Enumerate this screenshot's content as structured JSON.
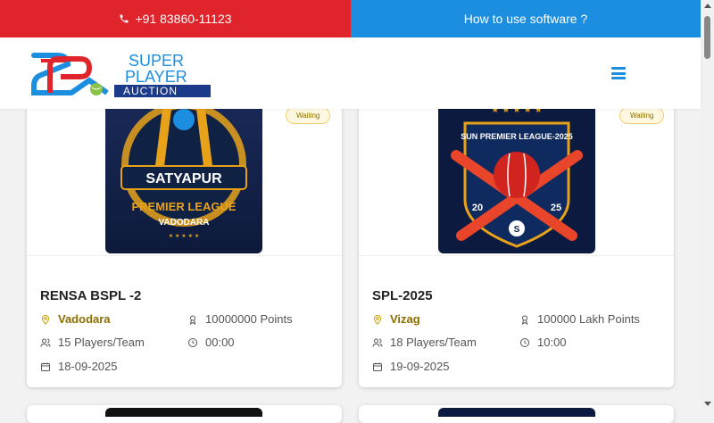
{
  "topbar": {
    "phone": "+91 83860-11123",
    "howto": "How to use software ?"
  },
  "logo": {
    "line1": "SUPER",
    "line2": "PLAYER",
    "line3": "AUCTION",
    "initials": "SPA"
  },
  "cards": [
    {
      "status": "Waiting",
      "title": "RENSA BSPL -2",
      "location": "Vadodara",
      "points": "10000000 Points",
      "players": "15 Players/Team",
      "time": "00:00",
      "date": "18-09-2025",
      "banner": {
        "line1": "SATYAPUR",
        "line2": "PREMIER LEAGUE",
        "line3": "VADODARA"
      }
    },
    {
      "status": "Waiting",
      "title": "SPL-2025",
      "location": "Vizag",
      "points": "100000 Lakh Points",
      "players": "18 Players/Team",
      "time": "10:00",
      "date": "19-09-2025",
      "banner": {
        "line1": "SUN PREMIER LEAGUE-2025",
        "year_left": "20",
        "year_right": "25",
        "letter": "S"
      }
    }
  ],
  "colors": {
    "red": "#e0242b",
    "blue": "#1b8ee0",
    "gold": "#c9a100"
  }
}
